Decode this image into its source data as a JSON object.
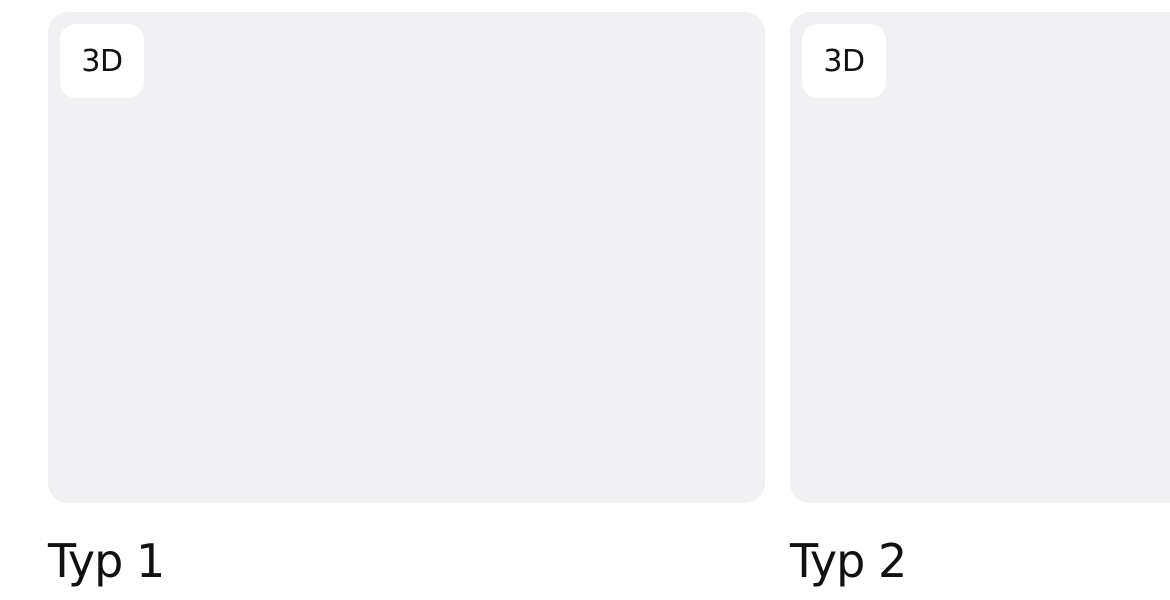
{
  "products": [
    {
      "badge": "3D",
      "title": "Typ 1"
    },
    {
      "badge": "3D",
      "title": "Typ 2"
    }
  ],
  "colors": {
    "card_background": "#f1f1f3",
    "badge_background": "#ffffff",
    "text": "#111111"
  }
}
